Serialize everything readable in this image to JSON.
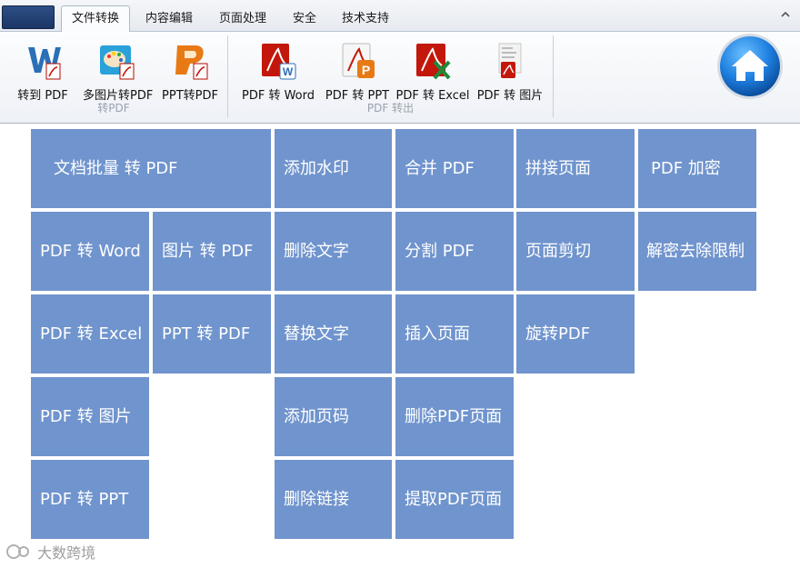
{
  "tabs": [
    {
      "label": "文件转换",
      "active": true
    },
    {
      "label": "内容编辑",
      "active": false
    },
    {
      "label": "页面处理",
      "active": false
    },
    {
      "label": "安全",
      "active": false
    },
    {
      "label": "技术支持",
      "active": false
    }
  ],
  "ribbon": {
    "group_to_pdf": {
      "label": "转PDF",
      "buttons": [
        {
          "label": "转到 PDF",
          "icon": "word-to-pdf-icon"
        },
        {
          "label": "多图片转PDF",
          "icon": "images-to-pdf-icon"
        },
        {
          "label": "PPT转PDF",
          "icon": "ppt-to-pdf-icon"
        }
      ]
    },
    "group_pdf_out": {
      "label": "PDF 转出",
      "buttons": [
        {
          "label": "PDF 转 Word",
          "icon": "pdf-to-word-icon"
        },
        {
          "label": "PDF 转 PPT",
          "icon": "pdf-to-ppt-icon"
        },
        {
          "label": "PDF 转 Excel",
          "icon": "pdf-to-excel-icon"
        },
        {
          "label": "PDF 转 图片",
          "icon": "pdf-to-image-icon"
        }
      ]
    },
    "home_icon": "home-icon"
  },
  "tiles": {
    "batch_to_pdf": "文档批量 转 PDF",
    "add_watermark": "添加水印",
    "merge_pdf": "合并 PDF",
    "join_pages": "拼接页面",
    "encrypt_pdf": "PDF 加密",
    "pdf_to_word": "PDF 转 Word",
    "image_to_pdf": "图片 转 PDF",
    "delete_text": "删除文字",
    "split_pdf": "分割 PDF",
    "crop_page": "页面剪切",
    "decrypt": "解密去除限制",
    "pdf_to_excel": "PDF 转 Excel",
    "ppt_to_pdf": "PPT 转 PDF",
    "replace_text": "替换文字",
    "insert_page": "插入页面",
    "rotate_pdf": "旋转PDF",
    "pdf_to_image": "PDF 转 图片",
    "add_page_number": "添加页码",
    "delete_pdf_page": "删除PDF页面",
    "pdf_to_ppt": "PDF 转 PPT",
    "delete_link": "删除链接",
    "extract_pdf_page": "提取PDF页面"
  },
  "colors": {
    "tile": "#7094cd",
    "tile_text": "#ffffff",
    "home": "#1e7fe0"
  },
  "watermark": "大数跨境"
}
